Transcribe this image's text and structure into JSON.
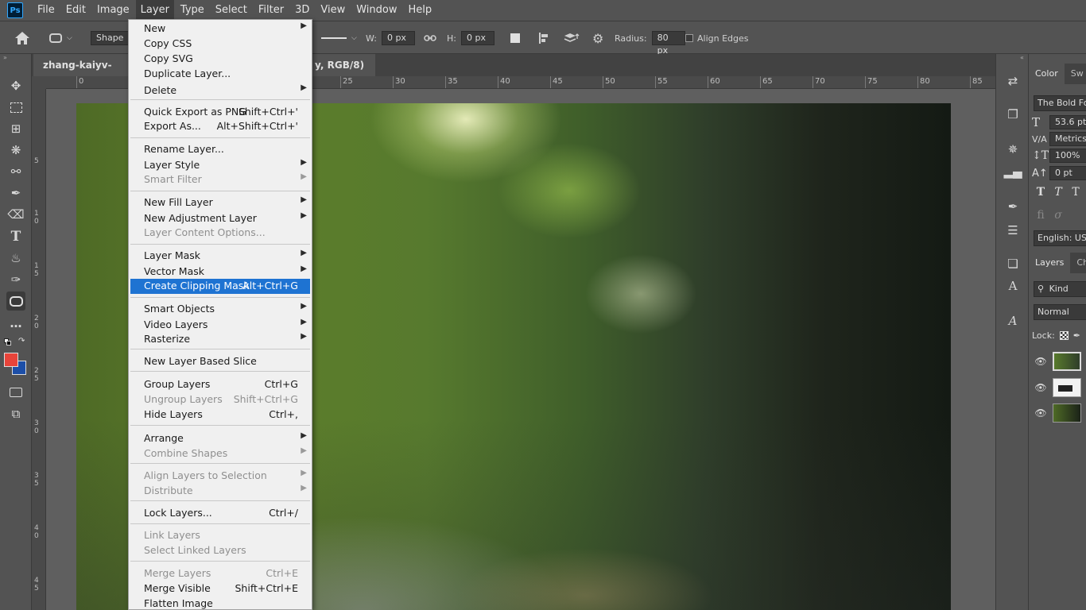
{
  "app": {
    "logo": "Ps"
  },
  "menubar": {
    "items": [
      "File",
      "Edit",
      "Image",
      "Layer",
      "Type",
      "Select",
      "Filter",
      "3D",
      "View",
      "Window",
      "Help"
    ],
    "active": "Layer"
  },
  "options": {
    "shape_mode": "Shape",
    "w_label": "W:",
    "w_value": "0 px",
    "h_label": "H:",
    "h_value": "0 px",
    "radius_label": "Radius:",
    "radius_value": "80 px",
    "align_edges": "Align Edges"
  },
  "document": {
    "tab_title_left": "zhang-kaiyv-FmylB",
    "tab_title_right": "y, RGB/8)",
    "tab_close": "×"
  },
  "ruler": {
    "h_labels": [
      "0",
      "25",
      "30",
      "35",
      "40",
      "45",
      "50",
      "55",
      "60",
      "65",
      "70",
      "75",
      "80",
      "85"
    ],
    "v_labels": [
      "5",
      "1\n0",
      "1\n5",
      "2\n0",
      "2\n5",
      "3\n0",
      "3\n5",
      "4\n0",
      "4\n5"
    ]
  },
  "layer_menu": {
    "items": [
      {
        "label": "New",
        "submenu": true
      },
      {
        "label": "Copy CSS"
      },
      {
        "label": "Copy SVG"
      },
      {
        "label": "Duplicate Layer..."
      },
      {
        "label": "Delete",
        "submenu": true
      },
      {
        "label": "Quick Export as PNG",
        "shortcut": "Shift+Ctrl+'"
      },
      {
        "label": "Export As...",
        "shortcut": "Alt+Shift+Ctrl+'"
      },
      {
        "label": "Rename Layer..."
      },
      {
        "label": "Layer Style",
        "submenu": true
      },
      {
        "label": "Smart Filter",
        "submenu": true,
        "disabled": true
      },
      {
        "label": "New Fill Layer",
        "submenu": true
      },
      {
        "label": "New Adjustment Layer",
        "submenu": true
      },
      {
        "label": "Layer Content Options...",
        "disabled": true
      },
      {
        "label": "Layer Mask",
        "submenu": true
      },
      {
        "label": "Vector Mask",
        "submenu": true
      },
      {
        "label": "Create Clipping Mask",
        "shortcut": "Alt+Ctrl+G",
        "highlighted": true
      },
      {
        "label": "Smart Objects",
        "submenu": true
      },
      {
        "label": "Video Layers",
        "submenu": true
      },
      {
        "label": "Rasterize",
        "submenu": true
      },
      {
        "label": "New Layer Based Slice"
      },
      {
        "label": "Group Layers",
        "shortcut": "Ctrl+G"
      },
      {
        "label": "Ungroup Layers",
        "shortcut": "Shift+Ctrl+G",
        "disabled": true
      },
      {
        "label": "Hide Layers",
        "shortcut": "Ctrl+,"
      },
      {
        "label": "Arrange",
        "submenu": true
      },
      {
        "label": "Combine Shapes",
        "submenu": true,
        "disabled": true
      },
      {
        "label": "Align Layers to Selection",
        "submenu": true,
        "disabled": true
      },
      {
        "label": "Distribute",
        "submenu": true,
        "disabled": true
      },
      {
        "label": "Lock Layers...",
        "shortcut": "Ctrl+/"
      },
      {
        "label": "Link Layers",
        "disabled": true
      },
      {
        "label": "Select Linked Layers",
        "disabled": true
      },
      {
        "label": "Merge Layers",
        "shortcut": "Ctrl+E",
        "disabled": true
      },
      {
        "label": "Merge Visible",
        "shortcut": "Shift+Ctrl+E"
      },
      {
        "label": "Flatten Image"
      }
    ]
  },
  "panels": {
    "top_tabs": [
      "Color",
      "Sw"
    ],
    "font_family": "The Bold Font",
    "font_size": "53.6 pt",
    "kerning": "Metrics",
    "vscale": "100%",
    "baseline": "0 pt",
    "language": "English: USA",
    "layers_tabs": [
      "Layers",
      "Ch"
    ],
    "filter_kind": "Kind",
    "blend_mode": "Normal",
    "lock_label": "Lock:"
  },
  "colors": {
    "foreground": "#e8443a",
    "background": "#1d4fa8",
    "menu_highlight": "#1e73d2"
  }
}
